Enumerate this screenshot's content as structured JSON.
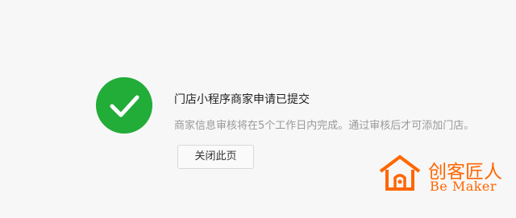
{
  "dialog": {
    "title": "门店小程序商家申请已提交",
    "description": "商家信息审核将在5个工作日内完成。通过审核后才可添加门店。",
    "close_button_label": "关闭此页",
    "status_icon": "checkmark-icon",
    "status_color": "#22ac38"
  },
  "watermark": {
    "brand_cn": "创客匠人",
    "brand_en": "Be Maker",
    "icon": "house-logo-icon",
    "color": "#ff6600"
  }
}
